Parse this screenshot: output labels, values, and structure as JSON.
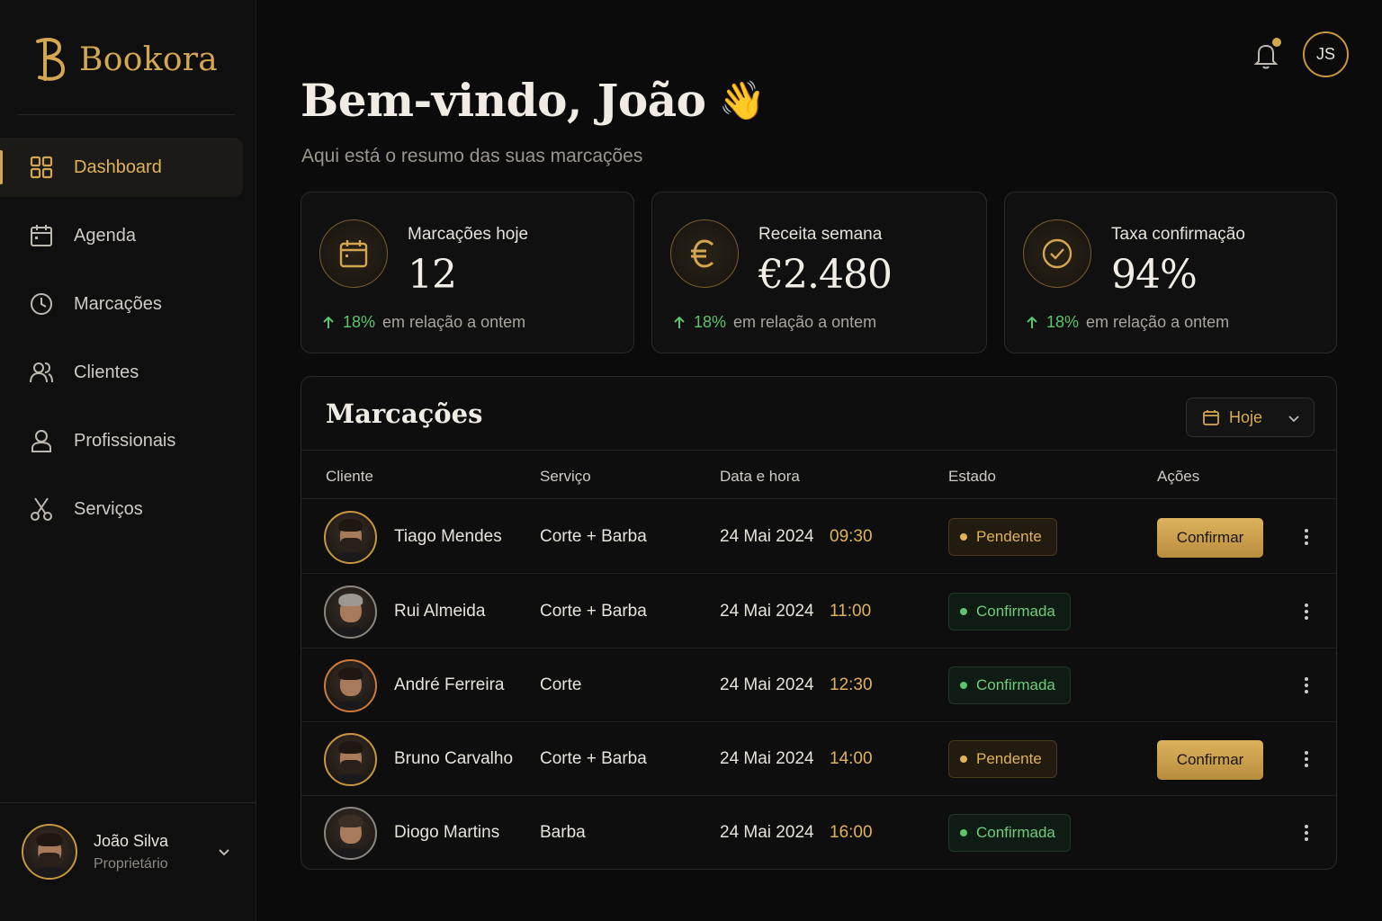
{
  "app": {
    "name": "Bookora"
  },
  "sidebar": {
    "items": [
      {
        "label": "Dashboard",
        "icon": "grid-icon",
        "active": true
      },
      {
        "label": "Agenda",
        "icon": "calendar-icon",
        "active": false
      },
      {
        "label": "Marcações",
        "icon": "clock-icon",
        "active": false
      },
      {
        "label": "Clientes",
        "icon": "users-icon",
        "active": false
      },
      {
        "label": "Profissionais",
        "icon": "user-icon",
        "active": false
      },
      {
        "label": "Serviços",
        "icon": "scissors-icon",
        "active": false
      }
    ],
    "user": {
      "name": "João Silva",
      "role": "Proprietário"
    }
  },
  "header": {
    "initials": "JS",
    "has_notification": true
  },
  "greeting": {
    "title": "Bem-vindo, João",
    "emoji": "👋",
    "subtitle": "Aqui está o resumo das suas marcações"
  },
  "stats": [
    {
      "label": "Marcações hoje",
      "value": "12",
      "change": "18%",
      "change_text": "em relação a ontem",
      "icon": "calendar-icon"
    },
    {
      "label": "Receita semana",
      "value": "€2.480",
      "change": "18%",
      "change_text": "em relação a ontem",
      "icon": "euro-icon"
    },
    {
      "label": "Taxa confirmação",
      "value": "94%",
      "change": "18%",
      "change_text": "em relação a ontem",
      "icon": "check-circle-icon"
    }
  ],
  "appointments": {
    "title": "Marcações",
    "filter": "Hoje",
    "columns": [
      "Cliente",
      "Serviço",
      "Data e hora",
      "Estado",
      "Ações"
    ],
    "rows": [
      {
        "client": "Tiago Mendes",
        "service": "Corte + Barba",
        "date": "24 Mai 2024",
        "time": "09:30",
        "status": "Pendente",
        "action": "Confirmar"
      },
      {
        "client": "Rui Almeida",
        "service": "Corte + Barba",
        "date": "24 Mai 2024",
        "time": "11:00",
        "status": "Confirmada",
        "action": ""
      },
      {
        "client": "André Ferreira",
        "service": "Corte",
        "date": "24 Mai 2024",
        "time": "12:30",
        "status": "Confirmada",
        "action": ""
      },
      {
        "client": "Bruno Carvalho",
        "service": "Corte + Barba",
        "date": "24 Mai 2024",
        "time": "14:00",
        "status": "Pendente",
        "action": "Confirmar"
      },
      {
        "client": "Diogo Martins",
        "service": "Barba",
        "date": "24 Mai 2024",
        "time": "16:00",
        "status": "Confirmada",
        "action": ""
      }
    ]
  },
  "colors": {
    "accent": "#d3a652",
    "background": "#0b0b0c",
    "positive": "#5ec46a"
  }
}
